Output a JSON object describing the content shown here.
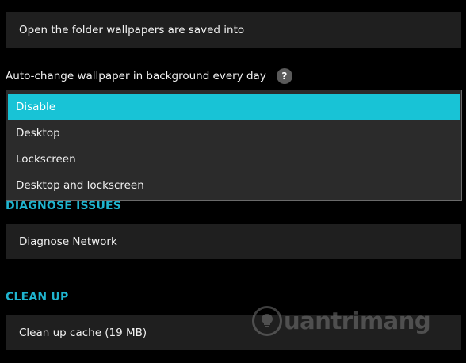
{
  "folder_button": {
    "label": "Open the folder wallpapers are saved into"
  },
  "autochange": {
    "label": "Auto-change wallpaper in background every day",
    "help_symbol": "?",
    "options": [
      "Disable",
      "Desktop",
      "Lockscreen",
      "Desktop and lockscreen"
    ],
    "selected": "Disable"
  },
  "diagnose": {
    "title": "DIAGNOSE ISSUES",
    "button_label": "Diagnose Network"
  },
  "cleanup": {
    "title": "CLEAN UP",
    "button_label": "Clean up cache (19 MB)"
  },
  "watermark": {
    "text": "uantrimang"
  },
  "colors": {
    "accent": "#18c3d6",
    "section_title": "#1fb4cf",
    "card_bg": "#1f1f1f",
    "background": "#000000"
  }
}
